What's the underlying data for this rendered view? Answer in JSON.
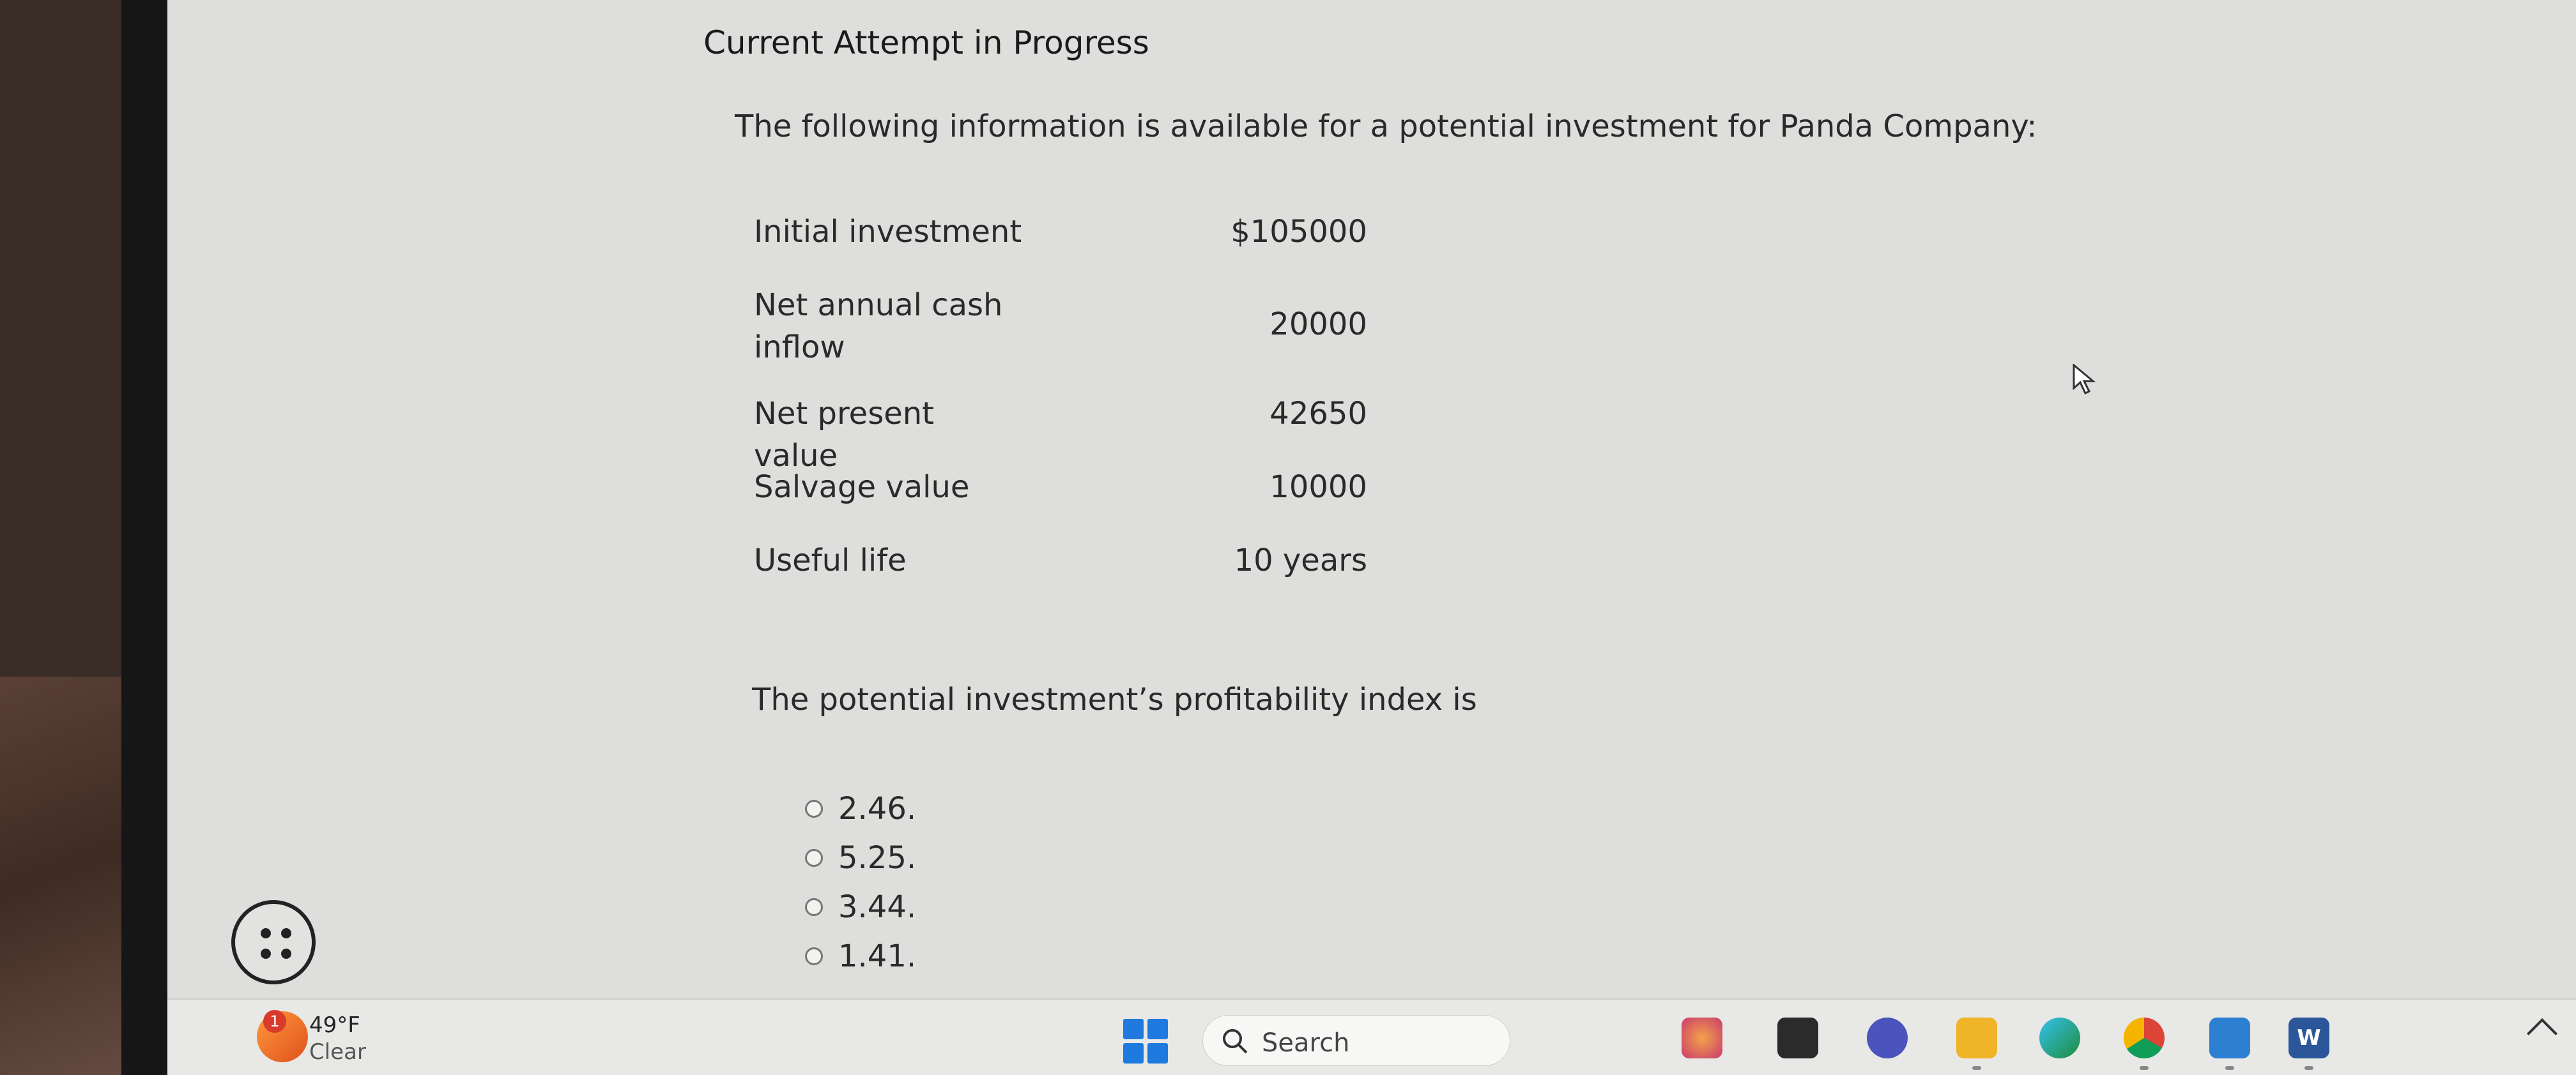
{
  "header": {
    "title": "Current Attempt in Progress"
  },
  "problem": {
    "intro": "The following information is available for a potential investment for Panda Company:",
    "rows": [
      {
        "label": "Initial investment",
        "value": "$105000"
      },
      {
        "label": "Net annual cash inflow",
        "value": "20000"
      },
      {
        "label": "Net present value",
        "value": "42650"
      },
      {
        "label": "Salvage value",
        "value": "10000"
      },
      {
        "label": "Useful life",
        "value": "10 years"
      }
    ],
    "question": "The potential investment’s profitability index is"
  },
  "options": [
    "2.46.",
    "5.25.",
    "3.44.",
    "1.41."
  ],
  "taskbar": {
    "weather_temp": "49°F",
    "weather_cond": "Clear",
    "weather_badge": "1",
    "search_label": "Search",
    "icons": [
      "windows-start",
      "search",
      "copilot",
      "file-explorer",
      "teams",
      "folder",
      "edge",
      "chrome",
      "store",
      "word"
    ]
  },
  "colors": {
    "page_bg": "#dededc",
    "text": "#2a2a2a",
    "windows_blue": "#1f7ae0"
  }
}
